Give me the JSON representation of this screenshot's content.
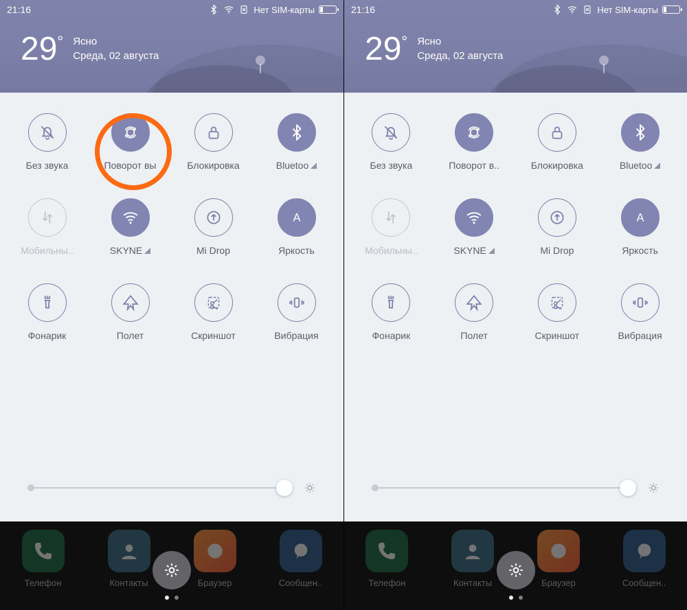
{
  "status": {
    "time": "21:16",
    "sim_text": "Нет SIM-карты"
  },
  "weather": {
    "temp": "29",
    "degree": "°",
    "condition": "Ясно",
    "date": "Среда, 02 августа"
  },
  "tiles": [
    {
      "key": "mute",
      "label": "Без звука",
      "state": "off",
      "icon": "bell-off"
    },
    {
      "key": "rotate",
      "label": "Поворот вы",
      "state": "active",
      "icon": "rotate"
    },
    {
      "key": "lock",
      "label": "Блокировка",
      "state": "off",
      "icon": "lock"
    },
    {
      "key": "bluetooth",
      "label": "Bluetoo",
      "state": "active",
      "icon": "bluetooth",
      "signal": true
    },
    {
      "key": "data",
      "label": "Мобильны..",
      "state": "disabled",
      "icon": "data"
    },
    {
      "key": "wifi",
      "label": "SKYNE",
      "state": "active",
      "icon": "wifi",
      "signal": true
    },
    {
      "key": "midrop",
      "label": "Mi Drop",
      "state": "off",
      "icon": "midrop"
    },
    {
      "key": "brightness",
      "label": "Яркость",
      "state": "active",
      "icon": "letter-a"
    },
    {
      "key": "torch",
      "label": "Фонарик",
      "state": "off",
      "icon": "torch"
    },
    {
      "key": "airplane",
      "label": "Полет",
      "state": "off",
      "icon": "plane"
    },
    {
      "key": "screenshot",
      "label": "Скриншот",
      "state": "off",
      "icon": "scissors"
    },
    {
      "key": "vibrate",
      "label": "Вибрация",
      "state": "off",
      "icon": "vibrate"
    }
  ],
  "tiles_right_variant": {
    "rotate_label": "Поворот в.."
  },
  "dock": [
    {
      "label": "Телефон",
      "cls": "ic-phone"
    },
    {
      "label": "Контакты",
      "cls": "ic-contacts"
    },
    {
      "label": "Браузер",
      "cls": "ic-browser"
    },
    {
      "label": "Сообщен..",
      "cls": "ic-msg"
    }
  ],
  "colors": {
    "accent": "#8285b1",
    "highlight": "#ff6a13"
  }
}
